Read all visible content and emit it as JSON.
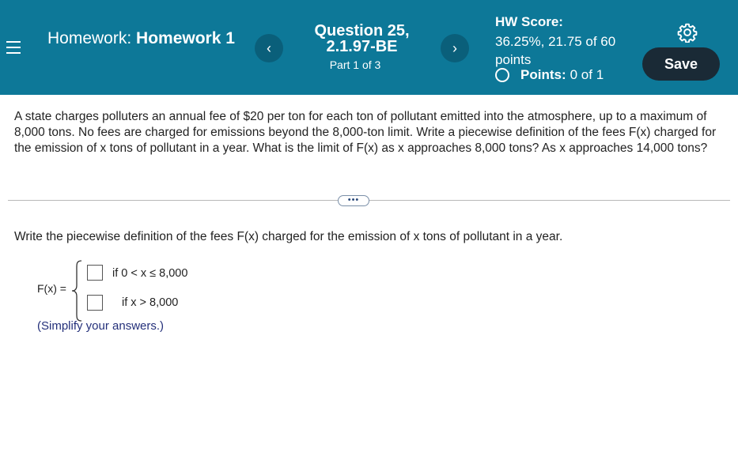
{
  "header": {
    "homework_prefix": "Homework:",
    "homework_name": "Homework 1",
    "question_title": "Question 25, 2.1.97-BE",
    "part_label": "Part 1 of 3",
    "prev_symbol": "‹",
    "next_symbol": "›",
    "hw_score_label": "HW Score:",
    "hw_score_value": "36.25%, 21.75 of 60 points",
    "points_label": "Points:",
    "points_value": "0 of 1",
    "save_label": "Save"
  },
  "question": {
    "text": "A state charges polluters an annual fee of $20 per ton for each ton of pollutant emitted into the atmosphere, up to a maximum of 8,000 tons. No fees are charged for emissions beyond the 8,000-ton limit. Write a piecewise definition of the fees F(x) charged for the emission of x tons of pollutant in a year. What is the limit of F(x) as x approaches 8,000 tons? As x approaches 14,000 tons?",
    "more_label": "•••"
  },
  "answer": {
    "instruction": "Write the piecewise definition of the fees F(x) charged for the emission of x tons of pollutant in a year.",
    "fx_label": "F(x) =",
    "condition_1": "if 0 < x ≤ 8,000",
    "condition_2": "if x > 8,000",
    "box_1_value": "",
    "box_2_value": "",
    "hint": "(Simplify your answers.)"
  },
  "colors": {
    "header_bg": "#0d7898",
    "save_bg": "#1a2a36",
    "hint_text": "#24307a"
  }
}
